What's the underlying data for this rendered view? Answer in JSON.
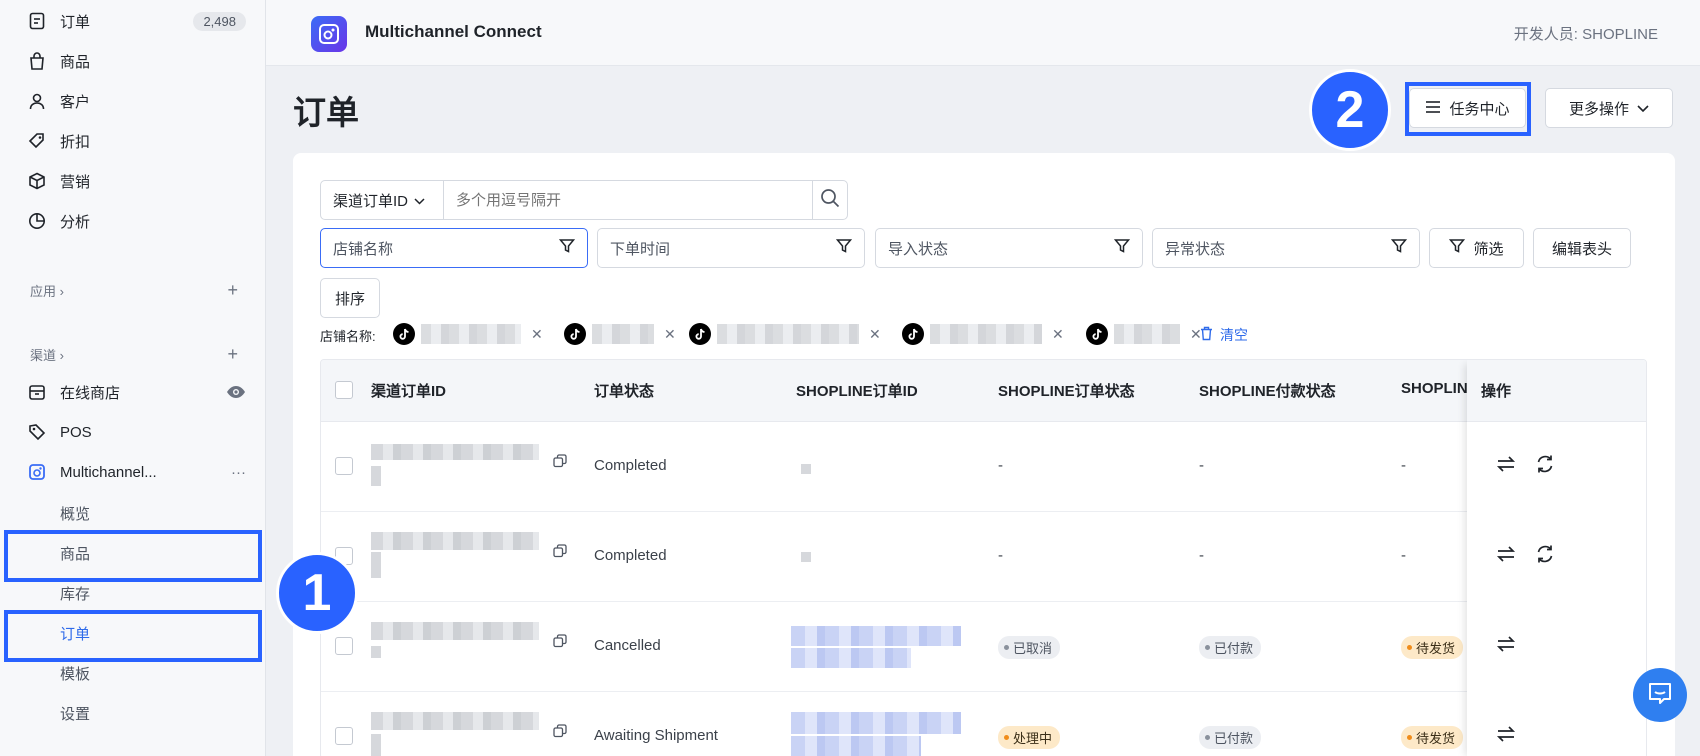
{
  "sidebar": {
    "orders": {
      "label": "订单",
      "count": "2,498",
      "icon": "order-doc-icon"
    },
    "products": {
      "label": "商品",
      "icon": "bag-icon"
    },
    "customers": {
      "label": "客户",
      "icon": "person-icon"
    },
    "discounts": {
      "label": "折扣",
      "icon": "tag-icon"
    },
    "marketing": {
      "label": "营销",
      "icon": "box-icon"
    },
    "analytics": {
      "label": "分析",
      "icon": "pie-icon"
    },
    "apps_header": {
      "label": "应用 ›",
      "plus": "+"
    },
    "channels_header": {
      "label": "渠道 ›",
      "plus": "+"
    },
    "online_store": {
      "label": "在线商店",
      "icon": "store-icon"
    },
    "pos": {
      "label": "POS",
      "icon": "pos-tag-icon"
    },
    "multichannel": {
      "label": "Multichannel...",
      "more": "···"
    },
    "sub": {
      "overview": "概览",
      "products": "商品",
      "inventory": "库存",
      "orders": "订单",
      "templates": "模板",
      "settings": "设置"
    }
  },
  "header": {
    "app_title": "Multichannel Connect",
    "developer": "开发人员: SHOPLINE"
  },
  "page": {
    "title": "订单",
    "task_center": "任务中心",
    "more_actions": "更多操作"
  },
  "steps": {
    "one": "1",
    "two": "2"
  },
  "colors": {
    "accent": "#2962ff",
    "link": "#2f6bea"
  },
  "filters": {
    "search_select": "渠道订单ID",
    "search_placeholder": "多个用逗号隔开",
    "store_name": "店铺名称",
    "order_time": "下单时间",
    "import_status": "导入状态",
    "exception_status": "异常状态",
    "filter_button": "筛选",
    "edit_header": "编辑表头",
    "sort": "排序",
    "applied_label": "店铺名称:",
    "clear": "清空"
  },
  "table": {
    "columns": [
      "渠道订单ID",
      "订单状态",
      "SHOPLINE订单ID",
      "SHOPLINE订单状态",
      "SHOPLINE付款状态",
      "SHOPLIN",
      "操作"
    ],
    "rows": [
      {
        "status": "Completed",
        "sl_status": "-",
        "pay_status": "-",
        "ship_status": "-"
      },
      {
        "status": "Completed",
        "sl_status": "-",
        "pay_status": "-",
        "ship_status": "-"
      },
      {
        "status": "Cancelled",
        "sl_status": "已取消",
        "pay_status": "已付款",
        "ship_status": "待发货"
      },
      {
        "status": "Awaiting Shipment",
        "sl_status": "处理中",
        "pay_status": "已付款",
        "ship_status": "待发货"
      }
    ]
  }
}
